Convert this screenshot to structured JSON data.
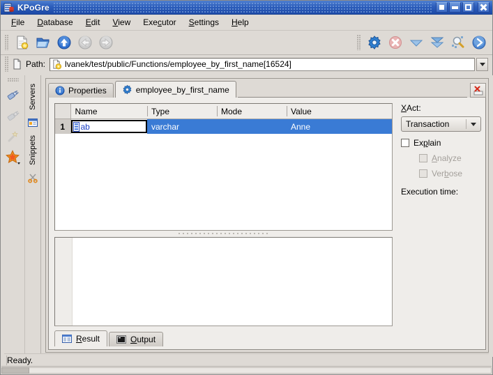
{
  "window": {
    "title": "KPoGre",
    "app_icon": "database-icon",
    "buttons": [
      {
        "name": "shade-button",
        "glyph": "shade"
      },
      {
        "name": "minimize-button",
        "glyph": "minimize"
      },
      {
        "name": "maximize-button",
        "glyph": "maximize"
      },
      {
        "name": "close-button",
        "glyph": "close"
      }
    ]
  },
  "menubar": {
    "items": [
      {
        "pre": "",
        "acc": "F",
        "post": "ile"
      },
      {
        "pre": "",
        "acc": "D",
        "post": "atabase"
      },
      {
        "pre": "",
        "acc": "E",
        "post": "dit"
      },
      {
        "pre": "",
        "acc": "V",
        "post": "iew"
      },
      {
        "pre": "Exe",
        "acc": "c",
        "post": "utor"
      },
      {
        "pre": "",
        "acc": "S",
        "post": "ettings"
      },
      {
        "pre": "",
        "acc": "H",
        "post": "elp"
      }
    ]
  },
  "toolbar": {
    "left_icons": [
      {
        "name": "new-document-icon",
        "title": "New"
      },
      {
        "name": "open-folder-icon",
        "title": "Open"
      },
      {
        "name": "go-up-icon",
        "title": "Up"
      },
      {
        "name": "go-back-icon",
        "title": "Back"
      },
      {
        "name": "go-forward-icon",
        "title": "Forward"
      }
    ],
    "right_icons": [
      {
        "name": "execute-gear-icon",
        "title": "Execute"
      },
      {
        "name": "stop-icon",
        "title": "Stop"
      },
      {
        "name": "fetch-next-icon",
        "title": "Fetch next"
      },
      {
        "name": "fetch-all-icon",
        "title": "Fetch all"
      },
      {
        "name": "find-icon",
        "title": "Find"
      },
      {
        "name": "run-icon",
        "title": "Run"
      }
    ]
  },
  "path": {
    "icon": "path-function-icon",
    "label": "Path:",
    "value": "lvanek/test/public/Functions/employee_by_first_name[16524]",
    "dropdown_icon": "chevron-down-icon"
  },
  "sidebar": {
    "tool_icons": [
      {
        "name": "connect-icon",
        "title": "Connect"
      },
      {
        "name": "disconnect-icon",
        "title": "Disconnect"
      },
      {
        "name": "wand-icon",
        "title": "Wizard"
      },
      {
        "name": "favourite-star-icon",
        "title": "Bookmark"
      }
    ],
    "vtabs": [
      {
        "name": "sidebar-tab-servers",
        "label": "Servers",
        "icon": "servers-icon",
        "selected": true
      },
      {
        "name": "sidebar-tab-snippets",
        "label": "Snippets",
        "icon": "scissors-icon",
        "selected": false
      }
    ]
  },
  "tabs": [
    {
      "name": "tab-properties",
      "label": "Properties",
      "icon": "info-icon",
      "active": false
    },
    {
      "name": "tab-function",
      "label": "employee_by_first_name",
      "icon": "gear-icon",
      "active": true
    }
  ],
  "tab_close": {
    "name": "close-tab-button",
    "icon": "close-tab-icon"
  },
  "params_table": {
    "columns": [
      "Name",
      "Type",
      "Mode",
      "Value"
    ],
    "rows": [
      {
        "num": "1",
        "name": "ab",
        "type": "varchar",
        "mode": "",
        "value": "Anne",
        "selected": true,
        "editing": true
      }
    ]
  },
  "executor": {
    "xact_label_pre": "",
    "xact_label_acc": "X",
    "xact_label_post": "Act:",
    "xact_value": "Transaction",
    "explain": {
      "label_pre": "Ex",
      "acc": "p",
      "label_post": "lain",
      "checked": false
    },
    "analyze": {
      "label_pre": "",
      "acc": "A",
      "label_post": "nalyze",
      "checked": false,
      "disabled": true
    },
    "verbose": {
      "label_pre": "Ver",
      "acc": "b",
      "label_post": "ose",
      "checked": false,
      "disabled": true
    },
    "execution_time_label": "Execution time:"
  },
  "bottom_tabs": [
    {
      "name": "tab-result",
      "pre": "",
      "acc": "R",
      "post": "esult",
      "icon": "result-list-icon",
      "active": true
    },
    {
      "name": "tab-output",
      "pre": "",
      "acc": "O",
      "post": "utput",
      "icon": "output-console-icon",
      "active": false
    }
  ],
  "status": {
    "text": "Ready."
  },
  "colors": {
    "title_blue": "#2c5dbb",
    "selection_blue": "#3a7bd5",
    "window_bg": "#dedad5",
    "panel_bg": "#efedea",
    "edit_text": "#1a3fc4"
  }
}
